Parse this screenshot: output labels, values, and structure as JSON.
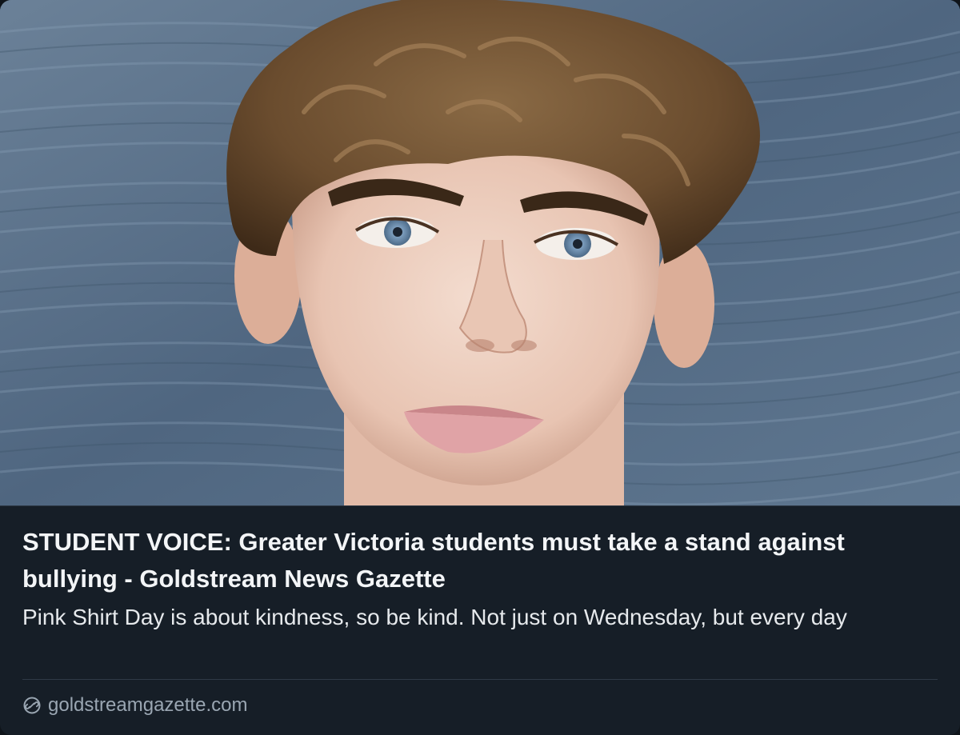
{
  "card": {
    "image_alt": "Portrait of a young man with curly brown hair and blue eyes",
    "headline": "STUDENT VOICE: Greater Victoria students must take a stand against bullying - Goldstream News Gazette",
    "description": "Pink Shirt Day is about kindness, so be kind. Not just on Wednesday, but every day",
    "source_domain": "goldstreamgazette.com",
    "source_icon": "link-icon"
  },
  "colors": {
    "card_background": "#161e27",
    "headline": "#f3f5f7",
    "description": "#e6e9ec",
    "source": "#9aa6b2",
    "photo_background": "#5b7188"
  }
}
